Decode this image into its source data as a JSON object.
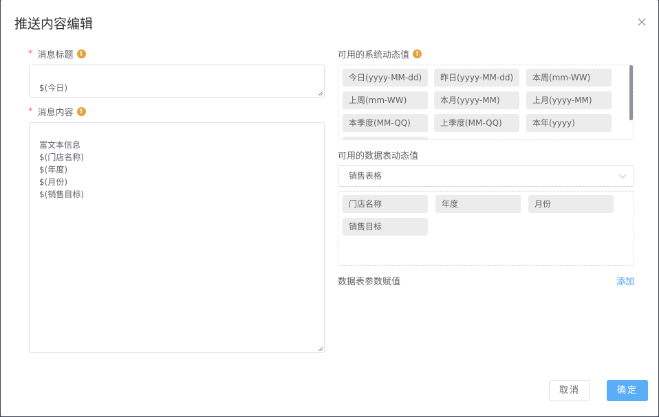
{
  "dialog": {
    "title": "推送内容编辑",
    "close_icon": "close-icon"
  },
  "left": {
    "title_field": {
      "required_mark": "*",
      "label": "消息标题",
      "info_icon": "!",
      "value": "$(今日)"
    },
    "content_field": {
      "required_mark": "*",
      "label": "消息内容",
      "info_icon": "!",
      "value": "富文本信息\n$(门店名称)\n$(年度)\n$(月份)\n$(销售目标)"
    }
  },
  "right": {
    "system_values": {
      "label": "可用的系统动态值",
      "info_icon": "!",
      "tags": [
        "今日(yyyy-MM-dd)",
        "昨日(yyyy-MM-dd)",
        "本周(mm-WW)",
        "上周(mm-WW)",
        "本月(yyyy-MM)",
        "上月(yyyy-MM)",
        "本季度(MM-QQ)",
        "上季度(MM-QQ)",
        "本年(yyyy)"
      ]
    },
    "table_values": {
      "label": "可用的数据表动态值",
      "select_value": "销售表格",
      "tags": [
        "门店名称",
        "年度",
        "月份",
        "销售目标"
      ]
    },
    "params": {
      "label": "数据表参数赋值",
      "add_link": "添加"
    }
  },
  "footer": {
    "cancel_label": "取消",
    "confirm_label": "确定"
  },
  "colors": {
    "primary": "#5aaef8",
    "link": "#409eff",
    "required": "#f56c6c",
    "warning": "#e6a23c"
  }
}
